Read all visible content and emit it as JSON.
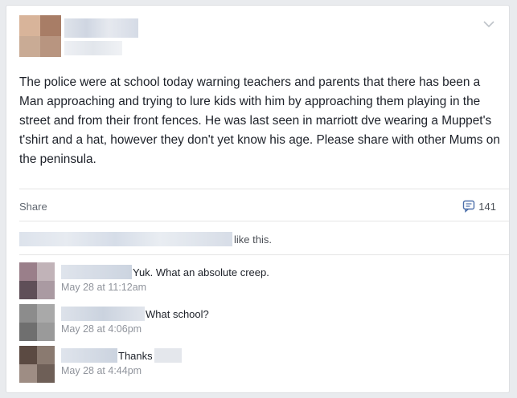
{
  "post": {
    "text": "The police were at school today warning teachers and parents that there has been a Man approaching and trying to lure kids with him by approaching them playing in the street and from their front fences. He was last seen in marriott dve wearing a Muppet's t'shirt and a hat, however they don't yet know his age. Please share with other Mums on the peninsula."
  },
  "actions": {
    "share_label": "Share",
    "comment_count": "141",
    "comment_icon": "comment-bubble-icon",
    "menu_icon": "chevron-down-icon"
  },
  "likes": {
    "suffix": "like this."
  },
  "comments": [
    {
      "text": "Yuk. What an absolute creep.",
      "time": "May 28 at 11:12am"
    },
    {
      "text": "What school?",
      "time": "May 28 at 4:06pm"
    },
    {
      "text": "Thanks",
      "time": "May 28 at 4:44pm"
    }
  ],
  "colors": {
    "background": "#e9ebee",
    "card": "#ffffff",
    "text": "#1d2129",
    "muted": "#90949c"
  }
}
